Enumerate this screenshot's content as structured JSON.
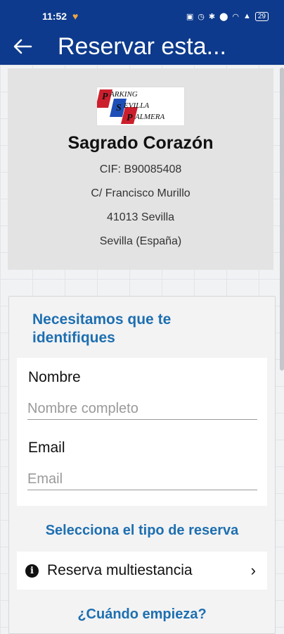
{
  "status_bar": {
    "time": "11:52",
    "battery": "29"
  },
  "app_bar": {
    "title": "Reservar esta..."
  },
  "company": {
    "logo_text": [
      "PARKING",
      "SEVILLA",
      "PALMERA"
    ],
    "name": "Sagrado Corazón",
    "cif": "CIF: B90085408",
    "address": "C/ Francisco Murillo",
    "postal": "41013 Sevilla",
    "region": "Sevilla (España)"
  },
  "identify": {
    "heading_line1": "Necesitamos que te",
    "heading_line2": "identifiques",
    "name_label": "Nombre",
    "name_placeholder": "Nombre completo",
    "email_label": "Email",
    "email_placeholder": "Email"
  },
  "reservation_type": {
    "heading": "Selecciona el tipo de reserva",
    "option_label": "Reserva multiestancia"
  },
  "start": {
    "heading": "¿Cuándo empieza?"
  },
  "colors": {
    "app_bar": "#0d3a8c",
    "accent": "#1e6fb0"
  }
}
